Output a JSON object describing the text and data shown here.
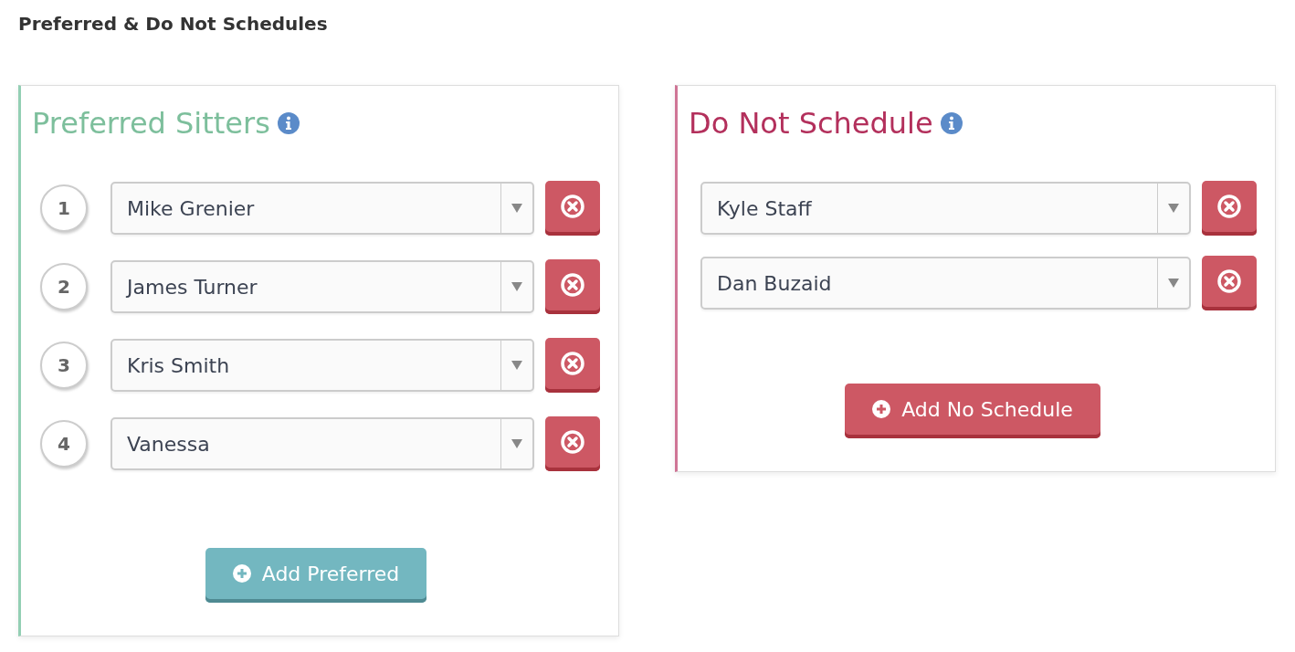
{
  "page_title": "Preferred & Do Not Schedules",
  "panels": [
    {
      "kind": "preferred",
      "title": "Preferred Sitters",
      "add_button": "Add Preferred",
      "rows": [
        {
          "number": "1",
          "value": "Mike Grenier"
        },
        {
          "number": "2",
          "value": "James Turner"
        },
        {
          "number": "3",
          "value": "Kris Smith"
        },
        {
          "number": "4",
          "value": "Vanessa"
        }
      ]
    },
    {
      "kind": "do_not",
      "title": "Do Not Schedule",
      "add_button": "Add No Schedule",
      "rows": [
        {
          "value": "Kyle Staff"
        },
        {
          "value": "Dan Buzaid"
        }
      ]
    }
  ]
}
